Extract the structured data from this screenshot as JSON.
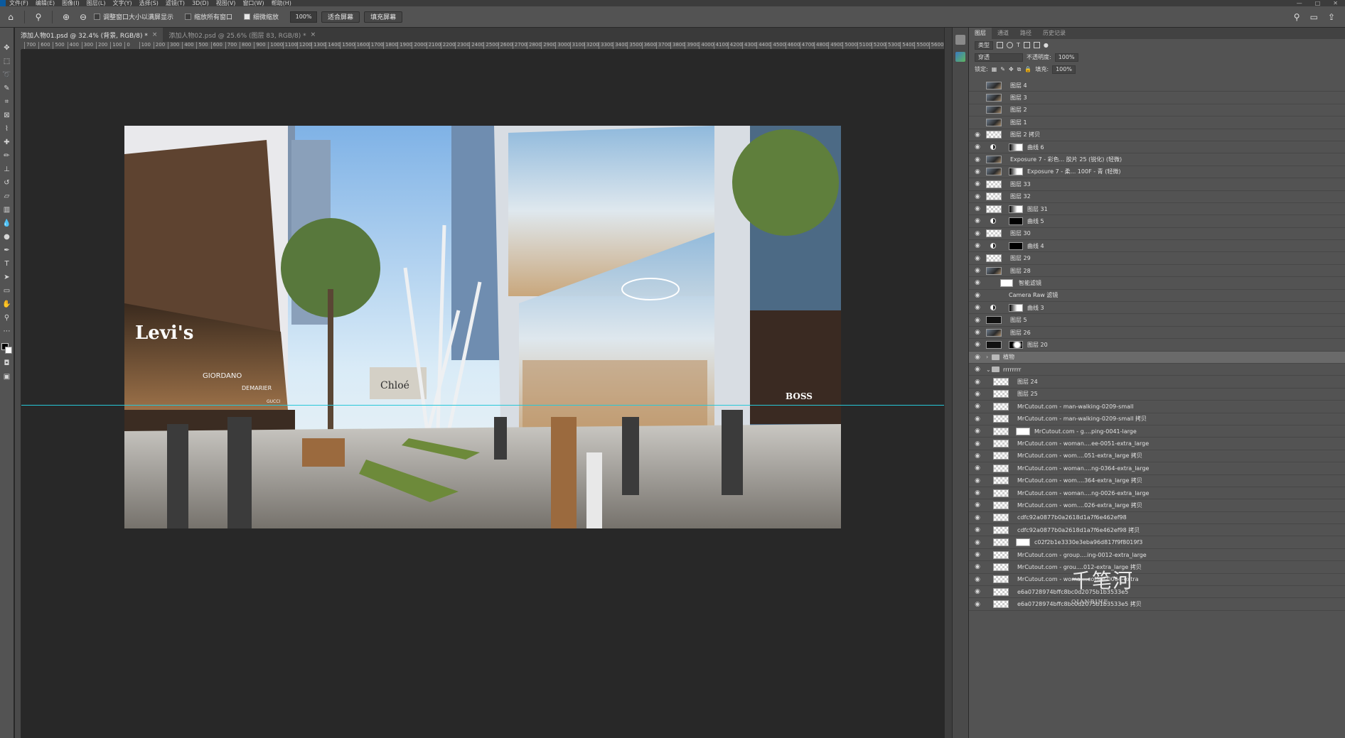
{
  "menu": [
    "文件(F)",
    "编辑(E)",
    "图像(I)",
    "图层(L)",
    "文字(Y)",
    "选择(S)",
    "滤镜(T)",
    "3D(D)",
    "视图(V)",
    "窗口(W)",
    "帮助(H)"
  ],
  "window_controls": [
    "—",
    "□",
    "✕"
  ],
  "options": {
    "resize_windows_label": "调整窗口大小以满屏显示",
    "zoom_all_label": "缩放所有窗口",
    "scrubby_zoom_label": "细微缩放",
    "zoom_value": "100%",
    "fit_screen_label": "适合屏幕",
    "fill_screen_label": "填充屏幕"
  },
  "tabs": [
    {
      "label": "添加人物01.psd @ 32.4% (背景, RGB/8) *",
      "close": "×"
    },
    {
      "label": "添加人物02.psd @ 25.6% (图层 83, RGB/8) *",
      "close": "×"
    }
  ],
  "ruler": [
    "700",
    "600",
    "500",
    "400",
    "300",
    "200",
    "100",
    "0",
    "100",
    "200",
    "300",
    "400",
    "500",
    "600",
    "700",
    "800",
    "900",
    "1000",
    "1100",
    "1200",
    "1300",
    "1400",
    "1500",
    "1600",
    "1700",
    "1800",
    "1900",
    "2000",
    "2100",
    "2200",
    "2300",
    "2400",
    "2500",
    "2600",
    "2700",
    "2800",
    "2900",
    "3000",
    "3100",
    "3200",
    "3300",
    "3400",
    "3500",
    "3600",
    "3700",
    "3800",
    "3900",
    "4000",
    "4100",
    "4200",
    "4300",
    "4400",
    "4500",
    "4600",
    "4700",
    "4800",
    "4900",
    "5000",
    "5100",
    "5200",
    "5300",
    "5400",
    "5500",
    "5600"
  ],
  "scene": {
    "store_sign_1": "Levi's",
    "store_sign_2": "GIORDANO",
    "store_sign_3": "DEMARIER",
    "store_sign_4": "GUCCI",
    "store_sign_5": "BOSS",
    "billboard": "Chloé"
  },
  "panel": {
    "tabs": [
      "图层",
      "通道",
      "路径",
      "历史记录"
    ],
    "filter_kind": "类型",
    "blend_mode": "穿透",
    "opacity_label": "不透明度:",
    "opacity_value": "100%",
    "lock_label": "锁定:",
    "fill_label": "填充:",
    "fill_value": "100%"
  },
  "layers": [
    {
      "name": "图层 4",
      "visible": false,
      "thumb": "photo"
    },
    {
      "name": "图层 3",
      "visible": false,
      "thumb": "photo"
    },
    {
      "name": "图层 2",
      "visible": false,
      "thumb": "photo"
    },
    {
      "name": "图层 1",
      "visible": false,
      "thumb": "photo"
    },
    {
      "name": "图层 2 拷贝",
      "visible": true,
      "thumb": "trans"
    },
    {
      "name": "曲线 6",
      "visible": true,
      "thumb": "adj",
      "mask": "grad"
    },
    {
      "name": "Exposure 7 - 彩色... 胶片 25 (锐化) (轻微)",
      "visible": true,
      "thumb": "photo"
    },
    {
      "name": "Exposure 7 - 柔... 100F - 青 (轻微)",
      "visible": true,
      "thumb": "photo",
      "mask": "grad"
    },
    {
      "name": "图层 33",
      "visible": true,
      "thumb": "trans"
    },
    {
      "name": "图层 32",
      "visible": true,
      "thumb": "trans"
    },
    {
      "name": "图层 31",
      "visible": true,
      "thumb": "trans",
      "mask": "grad"
    },
    {
      "name": "曲线 5",
      "visible": true,
      "thumb": "adj",
      "mask": "black"
    },
    {
      "name": "图层 30",
      "visible": true,
      "thumb": "trans"
    },
    {
      "name": "曲线 4",
      "visible": true,
      "thumb": "adj",
      "mask": "black"
    },
    {
      "name": "图层 29",
      "visible": true,
      "thumb": "trans"
    },
    {
      "name": "图层 28",
      "visible": true,
      "thumb": "photo"
    },
    {
      "name": "智能滤镜",
      "visible": true,
      "thumb": "smartfilter"
    },
    {
      "name": "Camera Raw 滤镜",
      "visible": true,
      "thumb": "none"
    },
    {
      "name": "曲线 3",
      "visible": true,
      "thumb": "adj",
      "mask": "grad"
    },
    {
      "name": "图层 5",
      "visible": true,
      "thumb": "dark"
    },
    {
      "name": "图层 26",
      "visible": true,
      "thumb": "photo"
    },
    {
      "name": "图层 20",
      "visible": true,
      "thumb": "dark",
      "mask": "blob"
    },
    {
      "name": "植物",
      "visible": true,
      "thumb": "folder",
      "selected": true
    },
    {
      "name": "rrrrrrrr",
      "visible": true,
      "thumb": "folder-open"
    },
    {
      "name": "图层 24",
      "visible": true,
      "thumb": "trans"
    },
    {
      "name": "图层 25",
      "visible": true,
      "thumb": "trans"
    },
    {
      "name": "MrCutout.com - man-walking-0209-small",
      "visible": true,
      "thumb": "trans"
    },
    {
      "name": "MrCutout.com - man-walking-0209-small 拷贝",
      "visible": true,
      "thumb": "trans"
    },
    {
      "name": "MrCutout.com - g....ping-0041-large",
      "visible": true,
      "thumb": "trans",
      "mask": "white"
    },
    {
      "name": "MrCutout.com - woman....ee-0051-extra_large",
      "visible": true,
      "thumb": "trans"
    },
    {
      "name": "MrCutout.com - wom....051-extra_large 拷贝",
      "visible": true,
      "thumb": "trans"
    },
    {
      "name": "MrCutout.com - woman....ng-0364-extra_large",
      "visible": true,
      "thumb": "trans"
    },
    {
      "name": "MrCutout.com - wom....364-extra_large 拷贝",
      "visible": true,
      "thumb": "trans"
    },
    {
      "name": "MrCutout.com - woman....ng-0026-extra_large",
      "visible": true,
      "thumb": "trans"
    },
    {
      "name": "MrCutout.com - wom....026-extra_large 拷贝",
      "visible": true,
      "thumb": "trans"
    },
    {
      "name": "cdfc92a0877b0a2618d1a7f6e462ef98",
      "visible": true,
      "thumb": "trans"
    },
    {
      "name": "cdfc92a0877b0a2618d1a7f6e462ef98 拷贝",
      "visible": true,
      "thumb": "trans"
    },
    {
      "name": "c02f2b1e3330e3eba96d817f9f8019f3",
      "visible": true,
      "thumb": "trans",
      "mask": "white"
    },
    {
      "name": "MrCutout.com - group....ing-0012-extra_large",
      "visible": true,
      "thumb": "trans"
    },
    {
      "name": "MrCutout.com - grou....012-extra_large 拷贝",
      "visible": true,
      "thumb": "trans"
    },
    {
      "name": "MrCutout.com - woma....coffee-0064-extra",
      "visible": true,
      "thumb": "trans"
    },
    {
      "name": "e6a0728974bffc8bc0d2075b1b3533e5",
      "visible": true,
      "thumb": "trans"
    },
    {
      "name": "e6a0728974bffc8bc0d2075b1b3533e5 拷贝",
      "visible": true,
      "thumb": "trans"
    }
  ],
  "watermark": {
    "main": "千笔河",
    "sub": "QIANBIHE"
  },
  "colors": {
    "guide": "#27c7d8",
    "canvas_bg": "#282828",
    "panel_bg": "#535353"
  }
}
